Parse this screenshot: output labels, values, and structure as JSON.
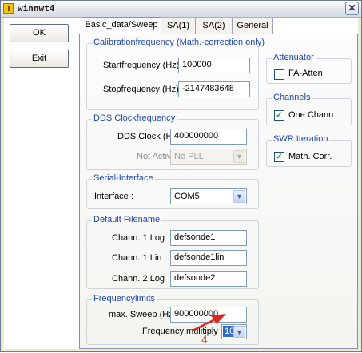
{
  "window": {
    "title": "winnwt4",
    "close_glyph": "✕",
    "close_icon": "close-icon"
  },
  "buttons": {
    "ok": "OK",
    "exit": "Exit"
  },
  "tabs": [
    "Basic_data/Sweep",
    "SA(1)",
    "SA(2)",
    "General"
  ],
  "calibration": {
    "title": "Calibrationfrequency (Math.-correction only)",
    "start_label": "Startfrequency (Hz)",
    "start_value": "100000",
    "stop_label": "Stopfrequency (Hz)",
    "stop_value": "-2147483648"
  },
  "dds": {
    "title": "DDS Clockfrequency",
    "clock_label": "DDS Clock (HZ)",
    "clock_value": "400000000",
    "not_active_label": "Not Active !",
    "pll_value": "No PLL"
  },
  "serial": {
    "title": "Serial-Interface",
    "interface_label": "Interface :",
    "interface_value": "COM5"
  },
  "filename": {
    "title": "Default Filename",
    "rows": [
      {
        "label": "Chann. 1  Log",
        "value": "defsonde1"
      },
      {
        "label": "Chann. 1  Lin",
        "value": "defsonde1lin"
      },
      {
        "label": "Chann. 2 Log",
        "value": "defsonde2"
      }
    ]
  },
  "frequencylimits": {
    "title": "Frequencylimits",
    "max_sweep_label": "max. Sweep (Hz)",
    "max_sweep_value": "900000000",
    "multiply_label": "Frequency mulitiply",
    "multiply_value": "10"
  },
  "attenuator": {
    "title": "Attenuator",
    "fa_atten_label": "FA-Atten",
    "fa_atten_checked": false
  },
  "channels": {
    "title": "Channels",
    "one_chann_label": "One Chann",
    "one_chann_checked": true
  },
  "swr": {
    "title": "SWR Iteration",
    "math_corr_label": "Math. Corr.",
    "math_corr_checked": true
  },
  "annotation": {
    "number": "4",
    "color": "#e2241a"
  }
}
